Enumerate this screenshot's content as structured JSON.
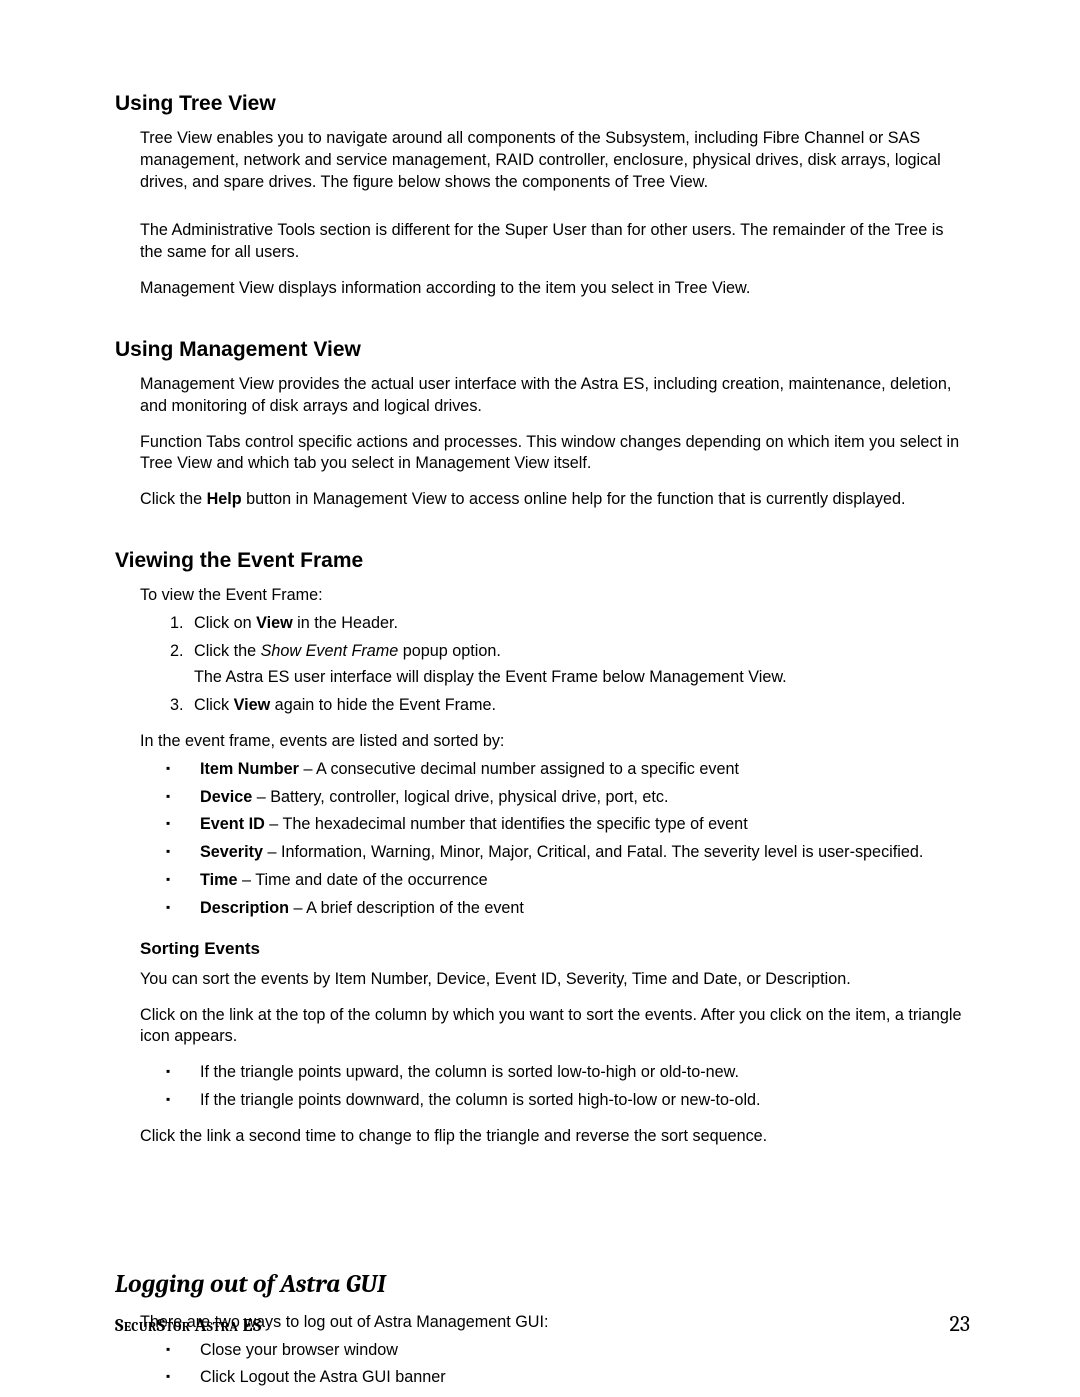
{
  "sections": {
    "tree": {
      "title": "Using Tree View",
      "p1": "Tree View enables you to navigate around all components of the Subsystem, including Fibre Channel or SAS management, network and service management, RAID controller, enclosure, physical drives, disk arrays, logical drives, and spare drives. The figure below shows the components of Tree View.",
      "p2": "The Administrative Tools section is different for the Super User than for other users. The remainder of the Tree is the same for all users.",
      "p3": "Management View displays information according to the item you select in Tree View."
    },
    "mgmt": {
      "title": "Using Management View",
      "p1": "Management View provides the actual user interface with the Astra ES, including creation, maintenance, deletion, and monitoring of disk arrays and logical drives.",
      "p2": "Function Tabs control specific actions and processes. This window changes depending on which item you select in Tree View and which tab you select in Management View itself.",
      "p3_pre": "Click the ",
      "p3_bold": "Help",
      "p3_post": " button in Management View to access online help for the function that is currently displayed."
    },
    "event": {
      "title": "Viewing the Event Frame",
      "intro": "To view the Event Frame:",
      "steps": {
        "s1_pre": "Click on ",
        "s1_bold": "View",
        "s1_post": " in the Header.",
        "s2_pre": "Click the ",
        "s2_em": "Show Event Frame",
        "s2_post": " popup option.",
        "s2_sub": "The Astra ES user interface will display the Event Frame below Management View.",
        "s3_pre": "Click ",
        "s3_bold": "View",
        "s3_post": " again to hide the Event Frame."
      },
      "listed_intro": "In the event frame, events are listed and sorted by:",
      "fields": {
        "f1_b": "Item Number",
        "f1_t": " – A consecutive decimal number assigned to a specific event",
        "f2_b": "Device",
        "f2_t": " – Battery, controller, logical drive, physical drive, port, etc.",
        "f3_b": "Event ID",
        "f3_t": " – The hexadecimal number that identifies the specific type of event",
        "f4_b": "Severity",
        "f4_t": " – Information, Warning, Minor, Major, Critical, and Fatal. The severity level is user-specified.",
        "f5_b": "Time",
        "f5_t": " – Time and date of the occurrence",
        "f6_b": "Description",
        "f6_t": " – A brief description of the event"
      },
      "sorting": {
        "title": "Sorting Events",
        "p1": "You can sort the events by Item Number, Device, Event ID, Severity, Time and Date, or Description.",
        "p2": "Click on the link at the top of the column by which you want to sort the events. After you click on the item, a triangle icon appears.",
        "b1": "If the triangle points upward, the column is sorted low-to-high or old-to-new.",
        "b2": "If the triangle points downward, the column is sorted high-to-low or new-to-old.",
        "p3": "Click the link a second time to change to flip the triangle and reverse the sort sequence."
      }
    },
    "logout": {
      "title": "Logging out of Astra GUI",
      "intro": "There are two ways to log out of Astra Management GUI:",
      "b1": "Close your browser window",
      "b2": "Click Logout the Astra GUI banner"
    }
  },
  "footer": {
    "product": "SecurStor Astra ES",
    "page": "23"
  }
}
